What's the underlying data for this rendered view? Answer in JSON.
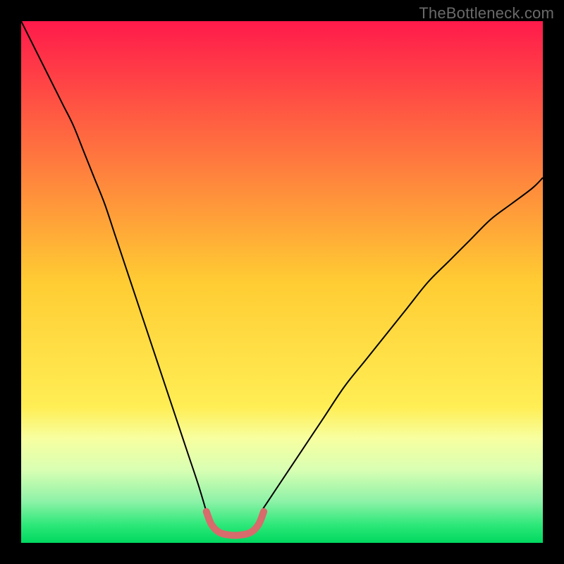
{
  "watermark": "TheBottleneck.com",
  "chart_data": {
    "type": "line",
    "title": "",
    "xlabel": "",
    "ylabel": "",
    "xlim": [
      0,
      100
    ],
    "ylim": [
      0,
      100
    ],
    "grid": false,
    "legend": false,
    "background_gradient": {
      "stops": [
        {
          "pos": 0.0,
          "color": "#ff1a4b"
        },
        {
          "pos": 0.5,
          "color": "#ffcc33"
        },
        {
          "pos": 0.74,
          "color": "#ffee55"
        },
        {
          "pos": 0.8,
          "color": "#f7ffa0"
        },
        {
          "pos": 0.86,
          "color": "#d9ffb3"
        },
        {
          "pos": 0.92,
          "color": "#8ef2a8"
        },
        {
          "pos": 0.965,
          "color": "#2ee87a"
        },
        {
          "pos": 1.0,
          "color": "#00d860"
        }
      ]
    },
    "series": [
      {
        "name": "bottleneck-curve-left",
        "stroke": "#000000",
        "width": 2,
        "x": [
          0,
          2,
          4,
          6,
          8,
          10,
          12,
          14,
          16,
          18,
          20,
          22,
          24,
          26,
          28,
          30,
          32,
          34,
          35.5
        ],
        "y": [
          100,
          96,
          92,
          88,
          84,
          80,
          75,
          70,
          65,
          59,
          53,
          47,
          41,
          35,
          29,
          23,
          17,
          11,
          6
        ]
      },
      {
        "name": "bottleneck-curve-right",
        "stroke": "#000000",
        "width": 2,
        "x": [
          46,
          48,
          50,
          54,
          58,
          62,
          66,
          70,
          74,
          78,
          82,
          86,
          90,
          94,
          98,
          100
        ],
        "y": [
          6,
          9,
          12,
          18,
          24,
          30,
          35,
          40,
          45,
          50,
          54,
          58,
          62,
          65,
          68,
          70
        ]
      },
      {
        "name": "bottleneck-valley-highlight",
        "stroke": "#d86b6b",
        "width": 10,
        "linecap": "round",
        "x": [
          35.5,
          36.5,
          38,
          40,
          42,
          44,
          45.5,
          46.5
        ],
        "y": [
          6,
          3.5,
          2,
          1.5,
          1.5,
          2,
          3.5,
          6
        ]
      }
    ]
  }
}
